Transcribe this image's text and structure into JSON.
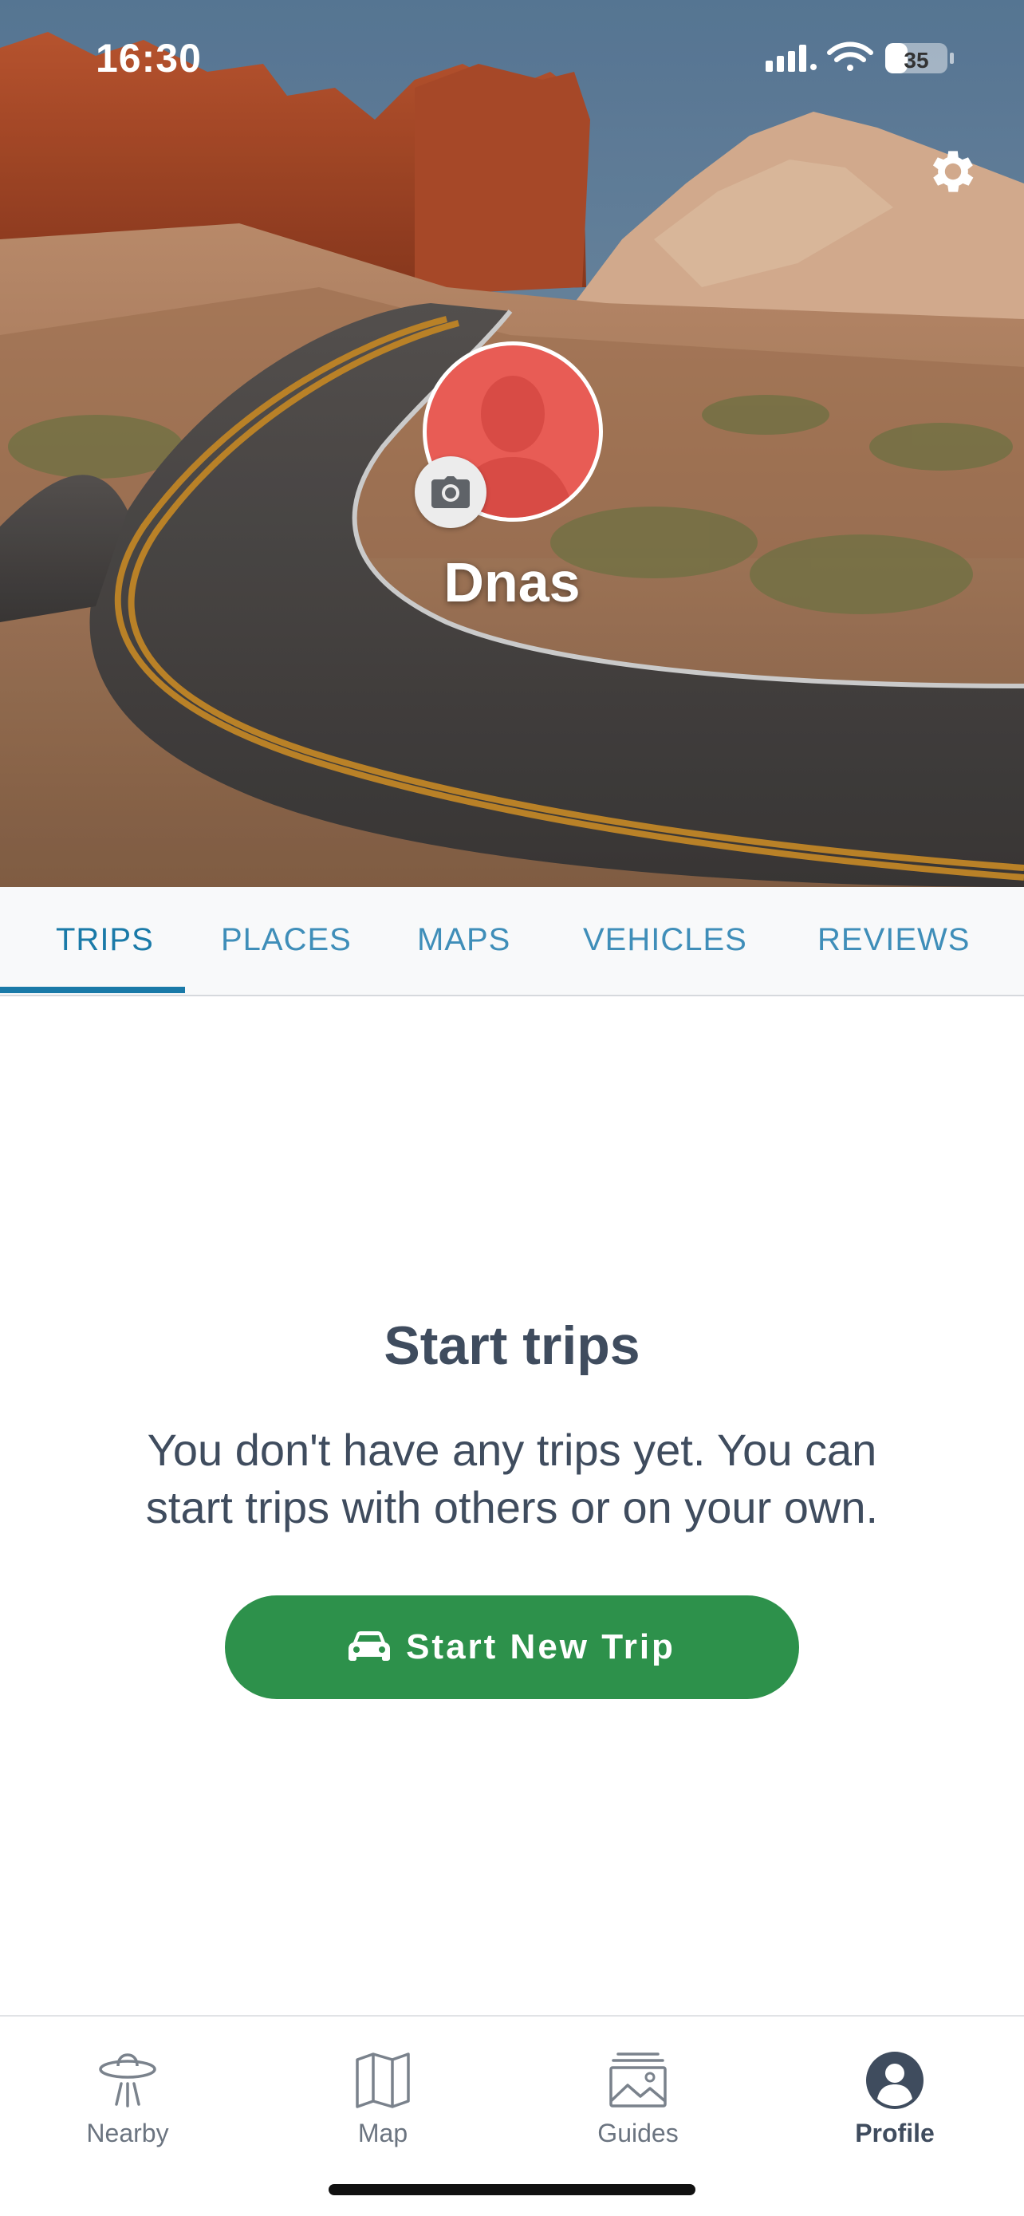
{
  "status_bar": {
    "time": "16:30",
    "battery": "35"
  },
  "profile": {
    "username": "Dnas"
  },
  "tabs": [
    {
      "label": "TRIPS",
      "active": true
    },
    {
      "label": "PLACES",
      "active": false
    },
    {
      "label": "MAPS",
      "active": false
    },
    {
      "label": "VEHICLES",
      "active": false
    },
    {
      "label": "REVIEWS",
      "active": false
    }
  ],
  "empty_state": {
    "title": "Start trips",
    "text": "You don't have any trips yet. You can start trips with others or on your own.",
    "button_label": "Start New Trip",
    "button_icon": "car-icon"
  },
  "bottom_nav": [
    {
      "label": "Nearby",
      "icon": "ufo-icon",
      "active": false
    },
    {
      "label": "Map",
      "icon": "map-icon",
      "active": false
    },
    {
      "label": "Guides",
      "icon": "guides-icon",
      "active": false
    },
    {
      "label": "Profile",
      "icon": "profile-icon",
      "active": true
    }
  ],
  "colors": {
    "accent": "#1a7aa8",
    "button_green": "#2d914b",
    "avatar_red": "#e85c55",
    "text_dark": "#3f4c5e"
  }
}
